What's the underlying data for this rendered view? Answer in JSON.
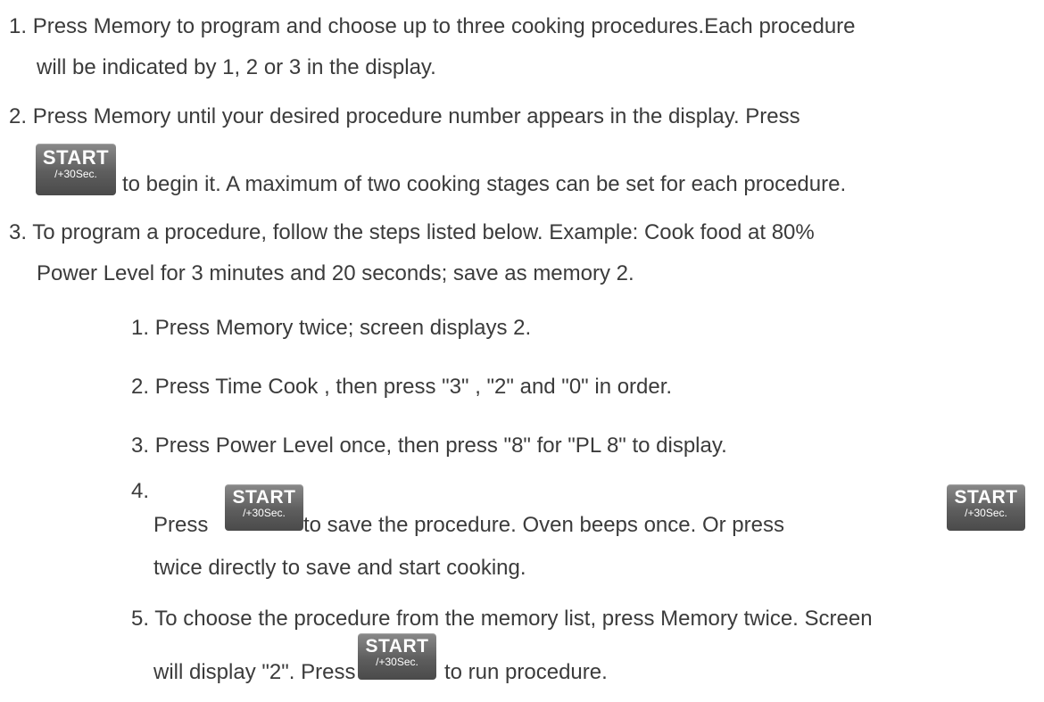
{
  "start_button": {
    "main": "START",
    "sub": "/+30Sec."
  },
  "steps": [
    {
      "num": "1.",
      "lines": [
        "Press Memory to program and choose up to three cooking procedures.Each procedure",
        "will be indicated by 1, 2 or 3 in the display."
      ]
    },
    {
      "num": "2.",
      "line1": "Press Memory until your desired procedure number appears in the display. Press",
      "line2": "to begin it. A maximum of two cooking stages can be set for each procedure."
    },
    {
      "num": "3.",
      "lines": [
        "To program a procedure, follow the steps listed below. Example: Cook food at 80%",
        "Power Level for 3 minutes and 20 seconds; save as memory 2."
      ]
    }
  ],
  "substeps": [
    {
      "num": "1.",
      "text": "Press Memory twice; screen displays 2."
    },
    {
      "num": "2.",
      "text": "Press Time Cook , then press \"3\" , \"2\" and \"0\" in order."
    },
    {
      "num": "3.",
      "text": "Press Power Level once, then press \"8\" for \"PL 8\" to display."
    },
    {
      "num": "4.",
      "press": "Press",
      "middle": "to save the procedure. Oven beeps once. Or press",
      "line2": "twice directly to save and start cooking."
    },
    {
      "num": "5.",
      "line1": "To choose the procedure from the memory list, press Memory twice. Screen",
      "prefix": "will display \"2\". Press",
      "suffix": "to run procedure."
    }
  ]
}
